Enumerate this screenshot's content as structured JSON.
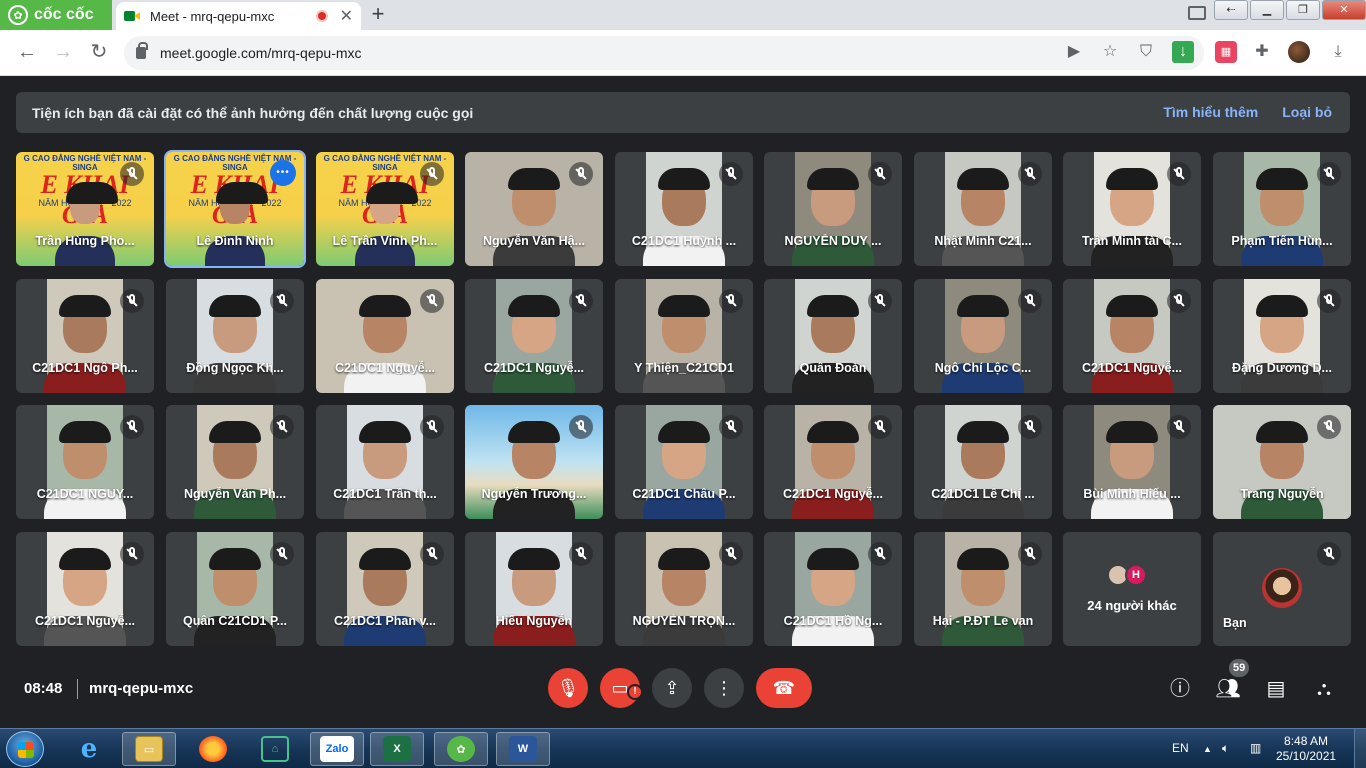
{
  "browser": {
    "brand": "cốc cốc",
    "tab_title": "Meet - mrq-qepu-mxc",
    "tab_close": "✕",
    "new_tab": "+",
    "url": "meet.google.com/mrq-qepu-mxc"
  },
  "banner": {
    "message": "Tiện ích bạn đã cài đặt có thể ảnh hưởng đến chất lượng cuộc gọi",
    "learn_more": "Tìm hiểu thêm",
    "dismiss": "Loại bỏ"
  },
  "tiles": [
    {
      "name": "Trần Hùng Pho...",
      "kind": "banner"
    },
    {
      "name": "Lê Đình Ninh",
      "kind": "banner",
      "speaking": true
    },
    {
      "name": "Lê Trần Vinh Ph...",
      "kind": "banner"
    },
    {
      "name": "Nguyễn Văn Hậ...",
      "kind": "full"
    },
    {
      "name": "C21DC1 Huỳnh ...",
      "kind": "pillar"
    },
    {
      "name": "NGUYỄN DUY ...",
      "kind": "pillar"
    },
    {
      "name": "Nhật Minh C21...",
      "kind": "pillar"
    },
    {
      "name": "Trần Minh tài C...",
      "kind": "pillar"
    },
    {
      "name": "Phạm Tiến Hùn...",
      "kind": "pillar"
    },
    {
      "name": "C21DC1 Ngô Ph...",
      "kind": "pillar"
    },
    {
      "name": "Đồng Ngọc Kh...",
      "kind": "pillar"
    },
    {
      "name": "C21DC1 Nguyễ...",
      "kind": "full"
    },
    {
      "name": "C21DC1 Nguyễ...",
      "kind": "pillar"
    },
    {
      "name": "Y Thiện_C21CD1",
      "kind": "pillar"
    },
    {
      "name": "Quân Đoàn",
      "kind": "pillar"
    },
    {
      "name": "Ngô Chí Lộc C...",
      "kind": "pillar"
    },
    {
      "name": "C21DC1 Nguyễ...",
      "kind": "pillar"
    },
    {
      "name": "Đặng Dương D...",
      "kind": "pillar"
    },
    {
      "name": "C21DC1 NGUY...",
      "kind": "pillar"
    },
    {
      "name": "Nguyễn Văn Ph...",
      "kind": "pillar"
    },
    {
      "name": "C21DC1 Trần th...",
      "kind": "pillar"
    },
    {
      "name": "Nguyễn Trương...",
      "kind": "full"
    },
    {
      "name": "C21DC1 Châu P...",
      "kind": "pillar"
    },
    {
      "name": "C21DC1 Nguyễ...",
      "kind": "pillar"
    },
    {
      "name": "C21DC1 Lê Chí ...",
      "kind": "pillar"
    },
    {
      "name": "Bùi Minh Hiếu ...",
      "kind": "pillar"
    },
    {
      "name": "Trang Nguyễn",
      "kind": "full"
    },
    {
      "name": "C21DC1 Nguyễ...",
      "kind": "pillar"
    },
    {
      "name": "Quân C21CD1 P...",
      "kind": "pillar"
    },
    {
      "name": "C21DC1 Phan v...",
      "kind": "pillar"
    },
    {
      "name": "Hiếu Nguyễn",
      "kind": "pillar"
    },
    {
      "name": "NGUYỄN TRỌN...",
      "kind": "pillar"
    },
    {
      "name": "C21DC1 Hồ Ng...",
      "kind": "pillar"
    },
    {
      "name": "Hai - P.ĐT Le van",
      "kind": "pillar"
    }
  ],
  "banner_text": {
    "school": "G CAO ĐẲNG NGHỀ VIỆT NAM - SINGA",
    "headline": "E KHAI GIẢ",
    "subline": "NĂM HỌC 2021 - 2022"
  },
  "others": {
    "label": "24 người khác",
    "initial": "H"
  },
  "self": {
    "label": "Bạn"
  },
  "bottom": {
    "time": "08:48",
    "meeting_code": "mrq-qepu-mxc",
    "participants_count": "59"
  },
  "taskbar": {
    "lang": "EN",
    "time": "8:48 AM",
    "date": "25/10/2021",
    "zalo": "Zalo"
  }
}
